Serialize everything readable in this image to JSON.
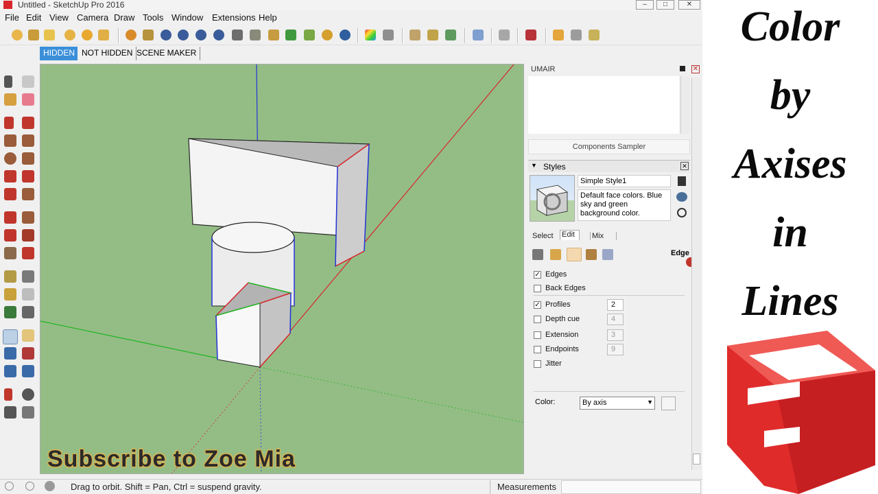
{
  "window": {
    "title": "Untitled - SketchUp Pro 2016",
    "minimize": "–",
    "maximize": "□",
    "close": "✕"
  },
  "menu": [
    "File",
    "Edit",
    "View",
    "Camera",
    "Draw",
    "Tools",
    "Window",
    "Extensions",
    "Help"
  ],
  "scene_tabs": [
    "HIDDEN",
    "NOT HIDDEN",
    "SCENE MAKER"
  ],
  "viewport": {
    "overlay_text": "Subscribe to Zoe Mia",
    "background_color": "#94bd86"
  },
  "tray": {
    "components_title": "UMAIR",
    "components_sampler": "Components Sampler",
    "styles": {
      "title": "Styles",
      "style_name": "Simple Style1",
      "description": "Default face colors. Blue sky and green background color.",
      "tabs": [
        "Select",
        "Edit",
        "Mix"
      ],
      "section_label": "Edge",
      "options": [
        {
          "label": "Edges",
          "checked": true,
          "value": ""
        },
        {
          "label": "Back Edges",
          "checked": false,
          "value": ""
        },
        {
          "label": "Profiles",
          "checked": true,
          "value": "2"
        },
        {
          "label": "Depth cue",
          "checked": false,
          "value": "4"
        },
        {
          "label": "Extension",
          "checked": false,
          "value": "3"
        },
        {
          "label": "Endpoints",
          "checked": false,
          "value": "9"
        },
        {
          "label": "Jitter",
          "checked": false,
          "value": ""
        }
      ],
      "color_label": "Color:",
      "color_value": "By axis"
    }
  },
  "status": {
    "hint": "Drag to orbit. Shift = Pan, Ctrl = suspend gravity.",
    "measurements_label": "Measurements"
  },
  "banner": {
    "words": [
      "Color",
      "by",
      "Axises",
      "in",
      "Lines"
    ],
    "logo": "sketchup-logo",
    "logo_color": "#e02b2b"
  },
  "colors": {
    "axis_red": "#d9252a",
    "axis_green": "#1fb51f",
    "axis_blue": "#2333d8",
    "selected_tab": "#3b8fd9"
  }
}
